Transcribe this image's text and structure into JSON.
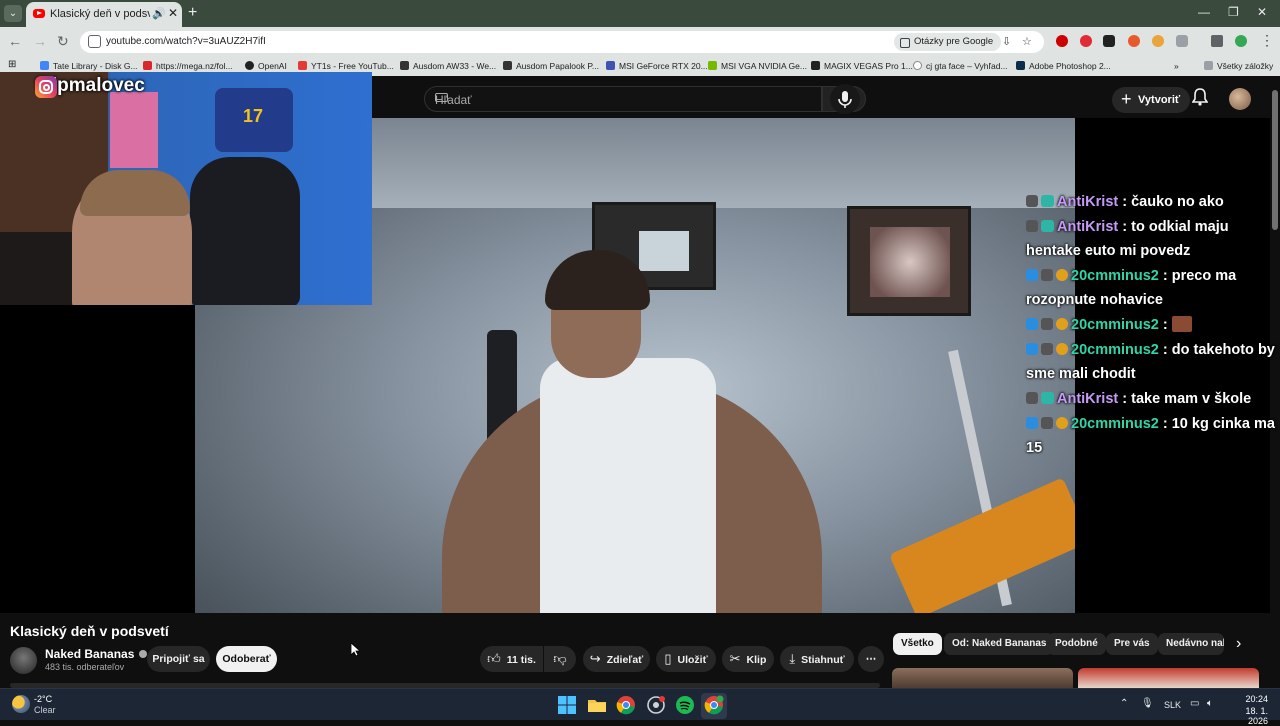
{
  "browser": {
    "tab_title": "Klasický deň v podsvetí - YouTube",
    "address": "youtube.com/watch?v=3uAUZ2H7ifI",
    "google_lens": "Otázky pre Google",
    "bookmarks": [
      "Tate Library - Disk G...",
      "https://mega.nz/fol...",
      "OpenAI",
      "YT1s - Free YouTub...",
      "Ausdom AW33 - We...",
      "Ausdom Papalook P...",
      "MSI GeForce RTX 20...",
      "MSI VGA NVIDIA Ge...",
      "MAGIX VEGAS Pro 1...",
      "cj gta face – Vyhľad...",
      "Adobe Photoshop 2..."
    ],
    "all_bookmarks": "Všetky záložky"
  },
  "youtube": {
    "search_placeholder": "Hľadať",
    "create_label": "Vytvoriť",
    "video_title": "Klasický deň v podsvetí",
    "channel_name": "Naked Bananas",
    "subscribers": "483 tis. odberateľov",
    "join_label": "Pripojiť sa",
    "subscribe_label": "Odoberať",
    "likes": "11 tis.",
    "share_label": "Zdieľať",
    "save_label": "Uložiť",
    "clip_label": "Klip",
    "download_label": "Stiahnuť",
    "chips": [
      "Všetko",
      "Od: Naked Bananas",
      "Podobné",
      "Pre vás",
      "Nedávno nahr"
    ]
  },
  "stream_overlay": {
    "instagram_handle": "filipmalovec",
    "chat": [
      {
        "user": "AntiKrist",
        "color": "purple",
        "text": ": čauko no ako"
      },
      {
        "user": "AntiKrist",
        "color": "purple",
        "text": ": to odkial maju hentake euto mi povedz"
      },
      {
        "user": "20cmminus2",
        "color": "green",
        "text": ": preco ma rozopnute nohavice"
      },
      {
        "user": "20cmminus2",
        "color": "green",
        "text": ":",
        "emote": true
      },
      {
        "user": "20cmminus2",
        "color": "green",
        "text": ": do takehoto by sme mali chodit"
      },
      {
        "user": "AntiKrist",
        "color": "purple",
        "text": ": take mam v škole"
      },
      {
        "user": "20cmminus2",
        "color": "green",
        "text": ": 10 kg cinka ma 15"
      }
    ],
    "webcam_shirt_number": "17"
  },
  "taskbar": {
    "temperature": "-2°C",
    "weather": "Clear",
    "language": "SLK",
    "time": "20:24",
    "date": "18. 1. 2026"
  }
}
